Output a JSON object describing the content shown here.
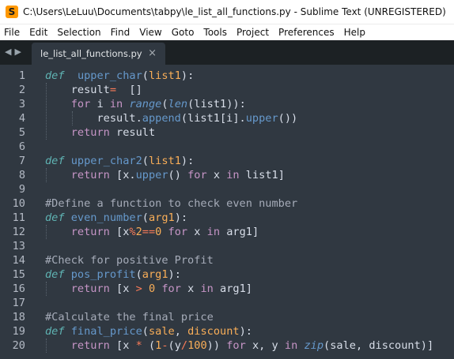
{
  "window": {
    "title": "C:\\Users\\LeLuu\\Documents\\tabpy\\le_list_all_functions.py - Sublime Text (UNREGISTERED)",
    "app_icon": "sublime-text-icon"
  },
  "menu": [
    "File",
    "Edit",
    "Selection",
    "Find",
    "View",
    "Goto",
    "Tools",
    "Project",
    "Preferences",
    "Help"
  ],
  "tabs": {
    "nav_left": "◀",
    "nav_right": "▶",
    "active": {
      "label": "le_list_all_functions.py",
      "close": "×"
    }
  },
  "editor": {
    "colors": {
      "background": "#303841",
      "keyword": "#5fb3b3",
      "function": "#6699cc",
      "param": "#f9ae58",
      "operator": "#f97b58",
      "comment": "#a6acb9"
    },
    "lines": [
      {
        "num": "1",
        "tokens": [
          [
            "kw",
            "def"
          ],
          [
            "",
            "  "
          ],
          [
            "fn",
            "upper_char"
          ],
          [
            "",
            "("
          ],
          [
            "par",
            "list1"
          ],
          [
            "",
            "):"
          ]
        ]
      },
      {
        "num": "2",
        "tokens": [
          [
            "",
            "    result"
          ],
          [
            "op",
            "="
          ],
          [
            "",
            ""
          ],
          [
            "",
            "  []"
          ]
        ]
      },
      {
        "num": "3",
        "tokens": [
          [
            "",
            "    "
          ],
          [
            "kwp",
            "for"
          ],
          [
            "",
            " i "
          ],
          [
            "kwp",
            "in"
          ],
          [
            "",
            " "
          ],
          [
            "bi",
            "range"
          ],
          [
            "",
            "("
          ],
          [
            "bi",
            "len"
          ],
          [
            "",
            "(list1)):"
          ]
        ]
      },
      {
        "num": "4",
        "tokens": [
          [
            "",
            "        result."
          ],
          [
            "meth",
            "append"
          ],
          [
            "",
            "(list1[i]."
          ],
          [
            "meth",
            "upper"
          ],
          [
            "",
            "())"
          ]
        ]
      },
      {
        "num": "5",
        "tokens": [
          [
            "",
            "    "
          ],
          [
            "kwp",
            "return"
          ],
          [
            "",
            " result"
          ]
        ]
      },
      {
        "num": "6",
        "tokens": []
      },
      {
        "num": "7",
        "tokens": [
          [
            "kw",
            "def"
          ],
          [
            "",
            " "
          ],
          [
            "fn",
            "upper_char2"
          ],
          [
            "",
            "("
          ],
          [
            "par",
            "list1"
          ],
          [
            "",
            "):"
          ]
        ]
      },
      {
        "num": "8",
        "tokens": [
          [
            "",
            "    "
          ],
          [
            "kwp",
            "return"
          ],
          [
            "",
            " [x."
          ],
          [
            "meth",
            "upper"
          ],
          [
            "",
            "() "
          ],
          [
            "kwp",
            "for"
          ],
          [
            "",
            " x "
          ],
          [
            "kwp",
            "in"
          ],
          [
            "",
            " list1]"
          ]
        ]
      },
      {
        "num": "9",
        "tokens": []
      },
      {
        "num": "10",
        "tokens": [
          [
            "cmt",
            "#Define a function to check even number"
          ]
        ]
      },
      {
        "num": "11",
        "tokens": [
          [
            "kw",
            "def"
          ],
          [
            "",
            " "
          ],
          [
            "fn",
            "even_number"
          ],
          [
            "",
            "("
          ],
          [
            "par",
            "arg1"
          ],
          [
            "",
            "):"
          ]
        ]
      },
      {
        "num": "12",
        "tokens": [
          [
            "",
            "    "
          ],
          [
            "kwp",
            "return"
          ],
          [
            "",
            " [x"
          ],
          [
            "op",
            "%"
          ],
          [
            "num",
            "2"
          ],
          [
            "op",
            "=="
          ],
          [
            "num",
            "0"
          ],
          [
            "",
            " "
          ],
          [
            "kwp",
            "for"
          ],
          [
            "",
            " x "
          ],
          [
            "kwp",
            "in"
          ],
          [
            "",
            " arg1]"
          ]
        ]
      },
      {
        "num": "13",
        "tokens": []
      },
      {
        "num": "14",
        "tokens": [
          [
            "cmt",
            "#Check for positive Profit"
          ]
        ]
      },
      {
        "num": "15",
        "tokens": [
          [
            "kw",
            "def"
          ],
          [
            "",
            " "
          ],
          [
            "fn",
            "pos_profit"
          ],
          [
            "",
            "("
          ],
          [
            "par",
            "arg1"
          ],
          [
            "",
            "):"
          ]
        ]
      },
      {
        "num": "16",
        "tokens": [
          [
            "",
            "    "
          ],
          [
            "kwp",
            "return"
          ],
          [
            "",
            " [x "
          ],
          [
            "op",
            ">"
          ],
          [
            "",
            " "
          ],
          [
            "num",
            "0"
          ],
          [
            "",
            " "
          ],
          [
            "kwp",
            "for"
          ],
          [
            "",
            " x "
          ],
          [
            "kwp",
            "in"
          ],
          [
            "",
            " arg1]"
          ]
        ]
      },
      {
        "num": "17",
        "tokens": []
      },
      {
        "num": "18",
        "tokens": [
          [
            "cmt",
            "#Calculate the final price"
          ]
        ]
      },
      {
        "num": "19",
        "tokens": [
          [
            "kw",
            "def"
          ],
          [
            "",
            " "
          ],
          [
            "fn",
            "final_price"
          ],
          [
            "",
            "("
          ],
          [
            "par",
            "sale"
          ],
          [
            "",
            ", "
          ],
          [
            "par",
            "discount"
          ],
          [
            "",
            "):"
          ]
        ]
      },
      {
        "num": "20",
        "tokens": [
          [
            "",
            "    "
          ],
          [
            "kwp",
            "return"
          ],
          [
            "",
            " [x "
          ],
          [
            "op",
            "*"
          ],
          [
            "",
            " ("
          ],
          [
            "num",
            "1"
          ],
          [
            "op",
            "-"
          ],
          [
            "",
            "(y"
          ],
          [
            "op",
            "/"
          ],
          [
            "num",
            "100"
          ],
          [
            "",
            "))"
          ],
          [
            "",
            " "
          ],
          [
            "kwp",
            "for"
          ],
          [
            "",
            " x, y "
          ],
          [
            "kwp",
            "in"
          ],
          [
            "",
            " "
          ],
          [
            "bi",
            "zip"
          ],
          [
            "",
            "(sale, discount)]"
          ]
        ]
      }
    ]
  }
}
